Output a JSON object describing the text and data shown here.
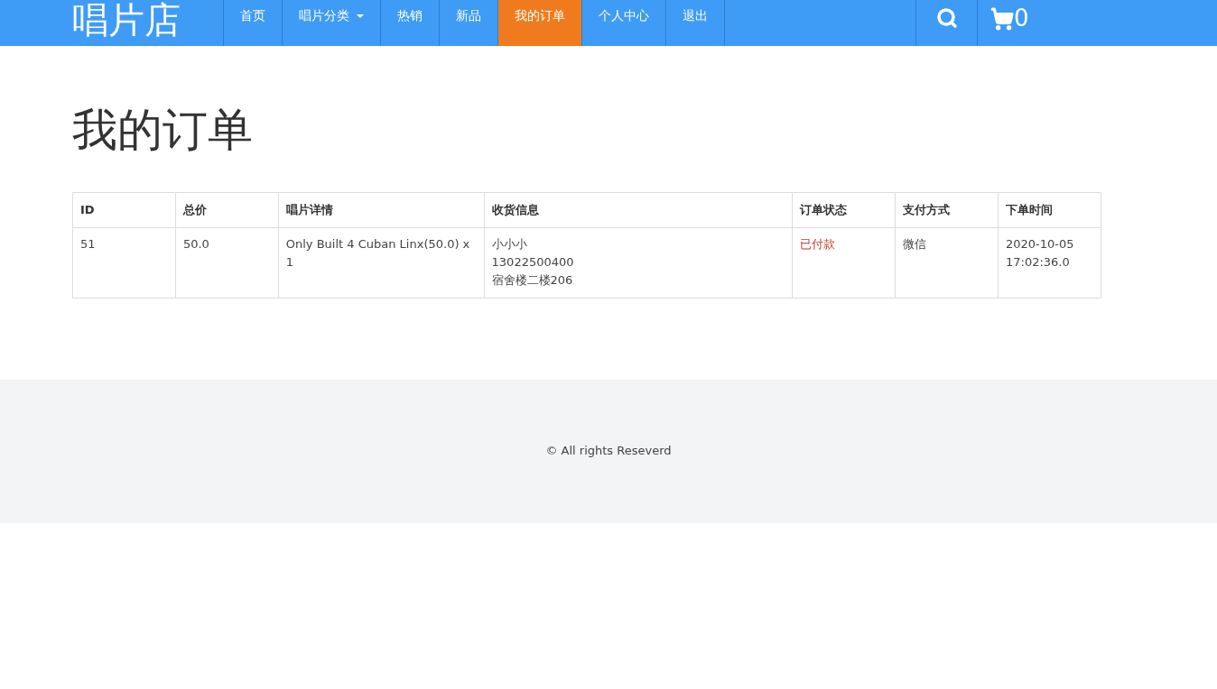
{
  "brand": "唱片店",
  "nav": [
    {
      "label": "首页",
      "kind": "link",
      "selected": false
    },
    {
      "label": "唱片分类",
      "kind": "dropdown",
      "selected": false
    },
    {
      "label": "热销",
      "kind": "link",
      "selected": false
    },
    {
      "label": "新品",
      "kind": "link",
      "selected": false
    },
    {
      "label": "我的订单",
      "kind": "link",
      "selected": true
    },
    {
      "label": "个人中心",
      "kind": "link",
      "selected": false
    },
    {
      "label": "退出",
      "kind": "link",
      "selected": false
    }
  ],
  "cart_count": "0",
  "heading": "我的订单",
  "table": {
    "columns": [
      "ID",
      "总价",
      "唱片详情",
      "收货信息",
      "订单状态",
      "支付方式",
      "下单时间"
    ],
    "rows": [
      {
        "cells": [
          {
            "kind": "text",
            "lines": [
              "51"
            ]
          },
          {
            "kind": "text",
            "lines": [
              "50.0"
            ]
          },
          {
            "kind": "text",
            "lines": [
              "Only Built 4 Cuban Linx(50.0) x 1"
            ]
          },
          {
            "kind": "text",
            "lines": [
              "小小小",
              "13022500400",
              "宿舍楼二楼206"
            ]
          },
          {
            "kind": "status",
            "lines": [
              "已付款"
            ]
          },
          {
            "kind": "text",
            "lines": [
              "微信"
            ]
          },
          {
            "kind": "text",
            "lines": [
              "2020-10-05",
              "17:02:36.0"
            ]
          }
        ]
      }
    ]
  },
  "footer": "© All rights Reseverd"
}
